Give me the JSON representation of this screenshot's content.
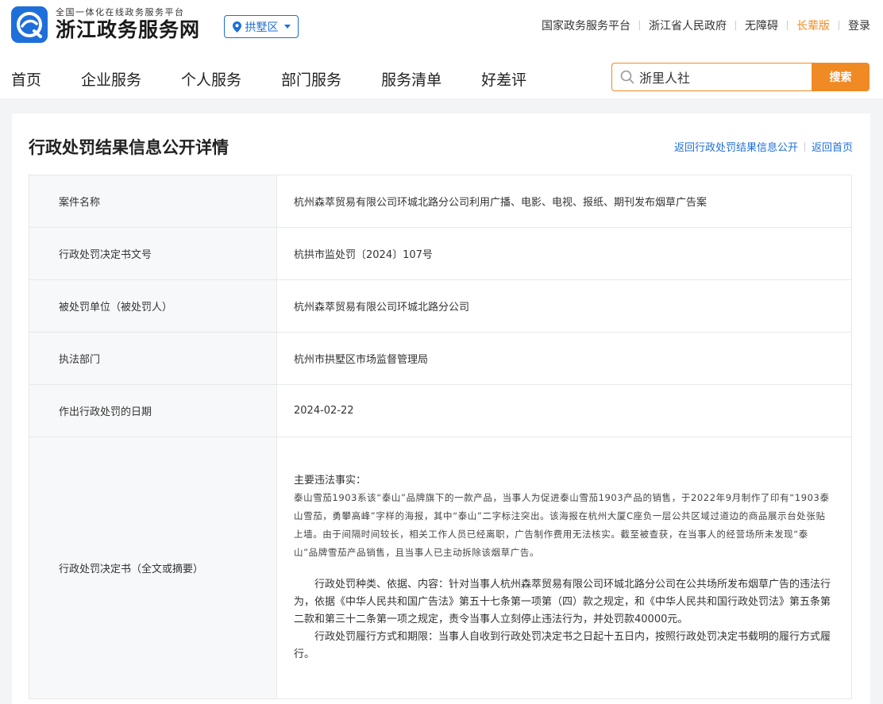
{
  "header": {
    "logo_subtitle": "全国一体化在线政务服务平台",
    "logo_title": "浙江政务服务网",
    "region": "拱墅区",
    "top_links": [
      "国家政务服务平台",
      "浙江省人民政府",
      "无障碍",
      "长辈版",
      "登录"
    ],
    "nav": [
      "首页",
      "企业服务",
      "个人服务",
      "部门服务",
      "服务清单",
      "好差评"
    ],
    "search": {
      "value": "浙里人社",
      "button": "搜索"
    },
    "colors": {
      "brand_blue": "#1e6fd9",
      "accent_orange": "#f08a24"
    }
  },
  "page": {
    "title": "行政处罚结果信息公开详情",
    "back_link": "返回行政处罚结果信息公开",
    "home_link": "返回首页"
  },
  "rows": [
    {
      "label": "案件名称",
      "value": "杭州森萃贸易有限公司环城北路分公司利用广播、电影、电视、报纸、期刊发布烟草广告案"
    },
    {
      "label": "行政处罚决定书文号",
      "value": "杭拱市监处罚〔2024〕107号"
    },
    {
      "label": "被处罚单位（被处罚人）",
      "value": "杭州森萃贸易有限公司环城北路分公司"
    },
    {
      "label": "执法部门",
      "value": "杭州市拱墅区市场监督管理局"
    },
    {
      "label": "作出行政处罚的日期",
      "value": "2024-02-22"
    }
  ],
  "decision": {
    "label": "行政处罚决定书（全文或摘要）",
    "facts_heading": "主要违法事实：",
    "facts": "泰山雪茄1903系该“泰山”品牌旗下的一款产品，当事人为促进泰山雪茄1903产品的销售，于2022年9月制作了印有“1903泰山雪茄，勇攀高峰”字样的海报，其中“泰山”二字标注突出。该海报在杭州大厦C座负一层公共区域过道边的商品展示台处张贴上墙。由于间隔时间较长，相关工作人员已经离职，广告制作费用无法核实。截至被查获，在当事人的经营场所未发现“泰山”品牌雪茄产品销售，且当事人已主动拆除该烟草广告。",
    "penalty": "行政处罚种类、依据、内容：针对当事人杭州森萃贸易有限公司环城北路分公司在公共场所发布烟草广告的违法行为，依据《中华人民共和国广告法》第五十七条第一项第（四）款之规定，和《中华人民共和国行政处罚法》第五条第二款和第三十二条第一项之规定，责令当事人立刻停止违法行为，并处罚款40000元。",
    "execution": "行政处罚履行方式和期限：当事人自收到行政处罚决定书之日起十五日内，按照行政处罚决定书载明的履行方式履行。"
  }
}
